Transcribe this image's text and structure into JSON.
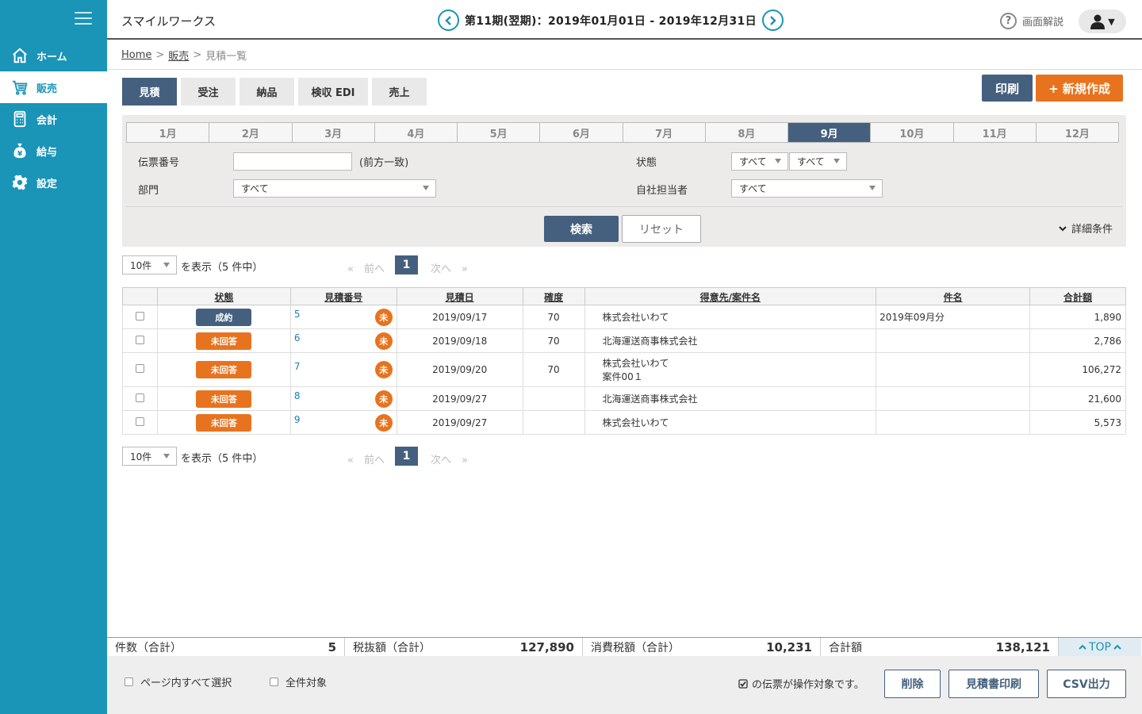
{
  "sidebar": {
    "items": [
      {
        "label": "ホーム",
        "icon": "home-icon"
      },
      {
        "label": "販売",
        "icon": "cart-icon"
      },
      {
        "label": "会計",
        "icon": "calculator-icon"
      },
      {
        "label": "給与",
        "icon": "money-bag-icon"
      },
      {
        "label": "設定",
        "icon": "gear-icon"
      }
    ]
  },
  "header": {
    "app_title": "スマイルワークス",
    "period": "第11期(翌期)：2019年01月01日 - 2019年12月31日",
    "help_label": "画面解説"
  },
  "breadcrumb": {
    "home": "Home",
    "sales": "販売",
    "current": "見積一覧",
    "sep": ">"
  },
  "tabs": [
    "見積",
    "受注",
    "納品",
    "検収 EDI",
    "売上"
  ],
  "actions": {
    "print": "印刷",
    "new": "+ 新規作成"
  },
  "months": [
    "1月",
    "2月",
    "3月",
    "4月",
    "5月",
    "6月",
    "7月",
    "8月",
    "9月",
    "10月",
    "11月",
    "12月"
  ],
  "filters": {
    "slip_label": "伝票番号",
    "slip_hint": "(前方一致)",
    "status_label": "状態",
    "status_value_1": "すべて",
    "status_value_2": "すべて",
    "dept_label": "部門",
    "dept_value": "すべて",
    "staff_label": "自社担当者",
    "staff_value": "すべて",
    "search": "検索",
    "reset": "リセット",
    "detail": "詳細条件"
  },
  "pager": {
    "per_page": "10件",
    "showing": "を表示（5 件中）",
    "prev": "«　前へ",
    "page": "1",
    "next": "次へ　»"
  },
  "table": {
    "headers": [
      "状態",
      "見積番号",
      "見積日",
      "確度",
      "得意先/案件名",
      "件名",
      "合計額"
    ],
    "rows": [
      {
        "status": "成約",
        "no": "5",
        "mark": "未",
        "date": "2019/09/17",
        "prob": "70",
        "client": "株式会社いわて",
        "project": "",
        "subject": "2019年09月分",
        "total": "1,890"
      },
      {
        "status": "未回答",
        "no": "6",
        "mark": "未",
        "date": "2019/09/18",
        "prob": "70",
        "client": "北海運送商事株式会社",
        "project": "",
        "subject": "",
        "total": "2,786"
      },
      {
        "status": "未回答",
        "no": "7",
        "mark": "未",
        "date": "2019/09/20",
        "prob": "70",
        "client": "株式会社いわて",
        "project": "案件00１",
        "subject": "",
        "total": "106,272"
      },
      {
        "status": "未回答",
        "no": "8",
        "mark": "未",
        "date": "2019/09/27",
        "prob": "",
        "client": "北海運送商事株式会社",
        "project": "",
        "subject": "",
        "total": "21,600"
      },
      {
        "status": "未回答",
        "no": "9",
        "mark": "未",
        "date": "2019/09/27",
        "prob": "",
        "client": "株式会社いわて",
        "project": "",
        "subject": "",
        "total": "5,573"
      }
    ]
  },
  "totals": {
    "count_label": "件数（合計）",
    "count": "5",
    "net_label": "税抜額（合計）",
    "net": "127,890",
    "tax_label": "消費税額（合計）",
    "tax": "10,231",
    "sum_label": "合計額",
    "sum": "138,121",
    "top": "TOP"
  },
  "bottom": {
    "select_page": "ページ内すべて選択",
    "select_all": "全件対象",
    "note": "の伝票が操作対象です。",
    "delete": "削除",
    "print_quote": "見積書印刷",
    "csv": "CSV出力"
  },
  "colors": {
    "sidebar": "#1a94b7",
    "primary": "#45607e",
    "accent": "#e8731f"
  }
}
